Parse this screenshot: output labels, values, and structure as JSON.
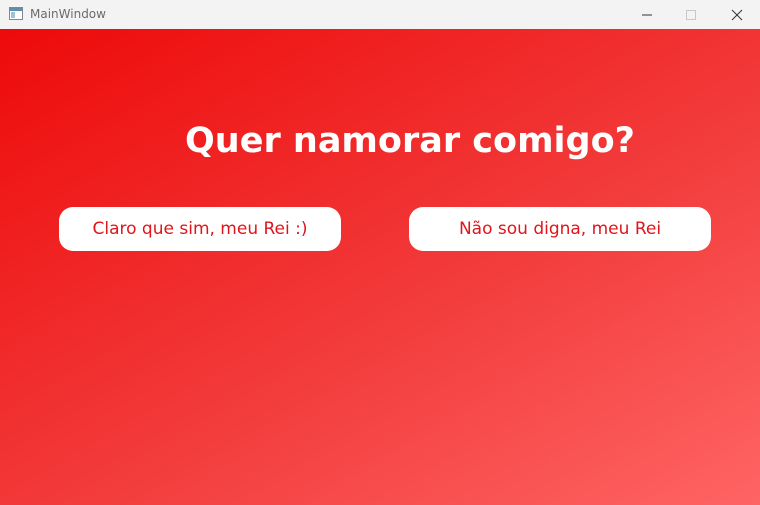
{
  "window": {
    "title": "MainWindow",
    "controls": {
      "minimize_icon": "minimize-icon",
      "maximize_icon": "maximize-icon",
      "close_icon": "close-icon"
    }
  },
  "main": {
    "question": "Quer namorar comigo?",
    "yes_button": "Claro que sim, meu Rei :)",
    "no_button": "Não sou digna, meu Rei"
  },
  "colors": {
    "gradient_start": "#ee0a0a",
    "gradient_end": "#ff6464",
    "button_text": "#e0141a",
    "button_bg": "#ffffff"
  }
}
